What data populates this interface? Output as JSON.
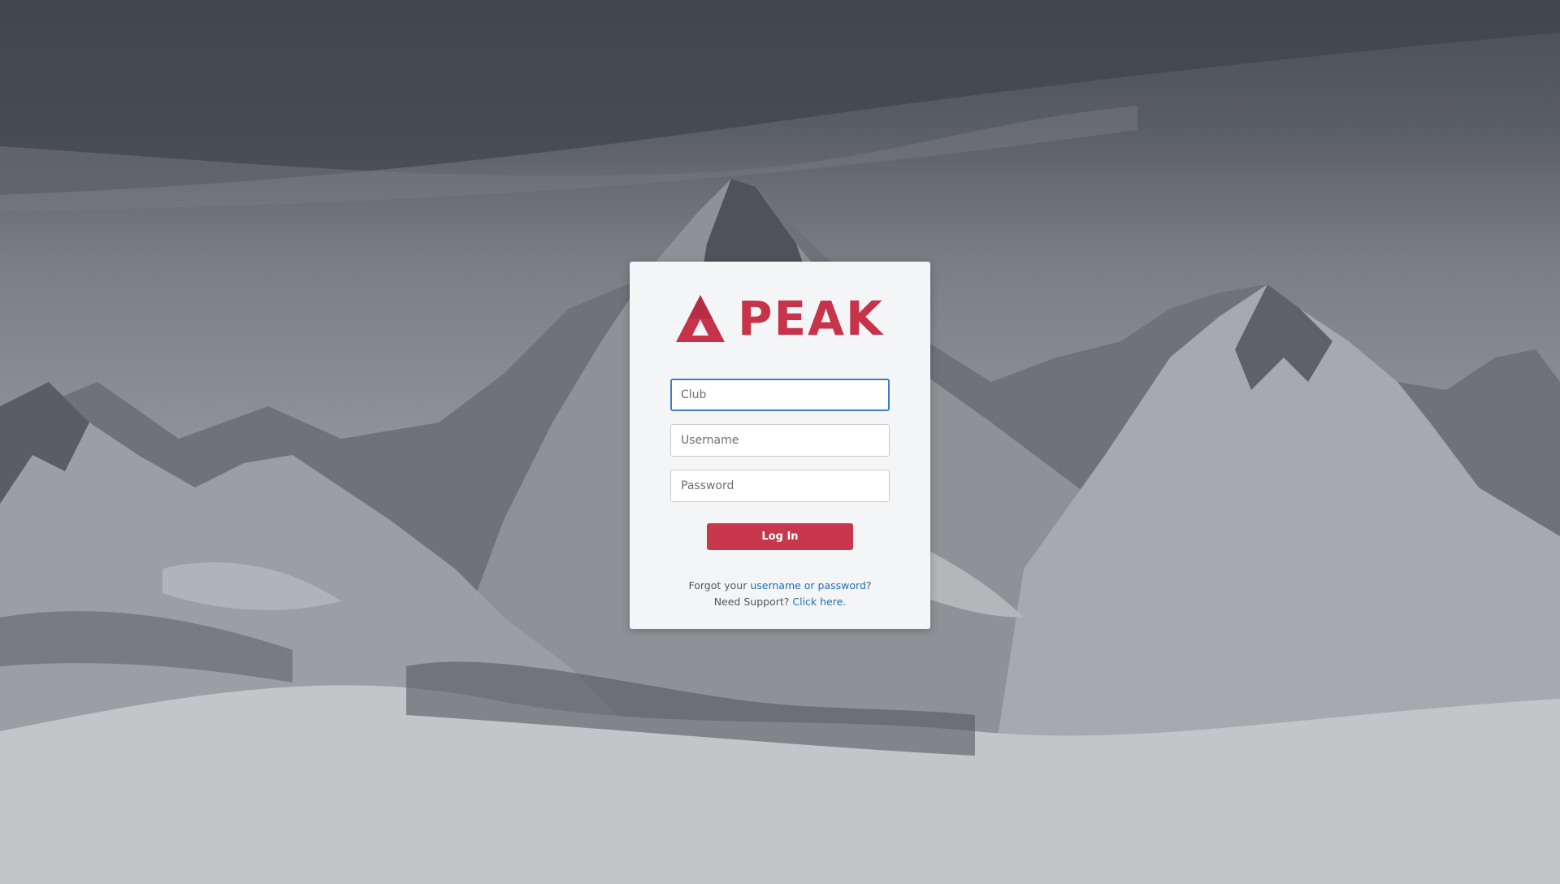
{
  "brand": {
    "name": "PEAK",
    "color": "#c6334b",
    "logo_icon": "triangle-mountain-icon"
  },
  "form": {
    "club_placeholder": "Club",
    "club_value": "",
    "username_placeholder": "Username",
    "username_value": "",
    "password_placeholder": "Password",
    "password_value": "",
    "login_label": "Log In"
  },
  "help": {
    "forgot_prefix": "Forgot your ",
    "forgot_link": "username or password",
    "forgot_suffix": "?",
    "support_prefix": "Need Support? ",
    "support_link": "Click here."
  },
  "colors": {
    "button": "#c8374b",
    "link": "#1f6fb5",
    "focus": "#3b7fc4"
  }
}
